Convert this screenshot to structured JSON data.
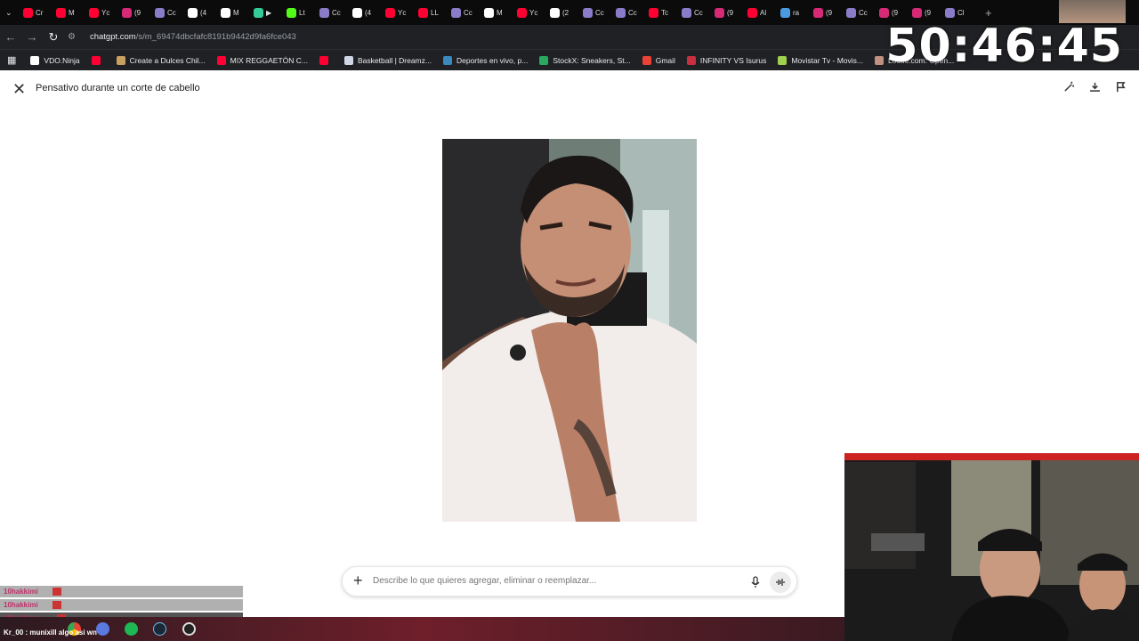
{
  "browser": {
    "tabs": [
      {
        "label": "Cr",
        "icon": "youtube-icon",
        "color": "#ff0033"
      },
      {
        "label": "M",
        "icon": "youtube-icon",
        "color": "#ff0033"
      },
      {
        "label": "Yc",
        "icon": "youtube-icon",
        "color": "#ff0033"
      },
      {
        "label": "(9",
        "icon": "instagram-icon",
        "color": "#d62976"
      },
      {
        "label": "Cc",
        "icon": "feather-icon",
        "color": "#8a7cc8"
      },
      {
        "label": "(4",
        "icon": "tiktok-icon",
        "color": "#ffffff"
      },
      {
        "label": "M",
        "icon": "tiktok-icon",
        "color": "#ffffff"
      },
      {
        "label": "▶",
        "icon": "loading-icon",
        "color": "#3c9"
      },
      {
        "label": "Lt",
        "icon": "kick-icon",
        "color": "#53fc18"
      },
      {
        "label": "Cc",
        "icon": "feather-icon",
        "color": "#8a7cc8"
      },
      {
        "label": "(4",
        "icon": "tiktok-icon",
        "color": "#ffffff"
      },
      {
        "label": "Yc",
        "icon": "youtube-icon",
        "color": "#ff0033"
      },
      {
        "label": "LL",
        "icon": "youtube-icon",
        "color": "#ff0033"
      },
      {
        "label": "Cc",
        "icon": "feather-icon",
        "color": "#8a7cc8"
      },
      {
        "label": "M",
        "icon": "tiktok-icon",
        "color": "#ffffff"
      },
      {
        "label": "Yc",
        "icon": "youtube-icon",
        "color": "#ff0033"
      },
      {
        "label": "(2",
        "icon": "x-icon",
        "color": "#ffffff"
      },
      {
        "label": "Cc",
        "icon": "feather-icon",
        "color": "#8a7cc8"
      },
      {
        "label": "Cc",
        "icon": "feather-icon",
        "color": "#8a7cc8"
      },
      {
        "label": "Tc",
        "icon": "youtube-icon",
        "color": "#ff0033"
      },
      {
        "label": "Cc",
        "icon": "feather-icon",
        "color": "#8a7cc8"
      },
      {
        "label": "(9",
        "icon": "instagram-icon",
        "color": "#d62976"
      },
      {
        "label": "Al",
        "icon": "youtube-icon",
        "color": "#ff0033"
      },
      {
        "label": "ra",
        "icon": "app-icon",
        "color": "#4a9ae0"
      },
      {
        "label": "(9",
        "icon": "instagram-icon",
        "color": "#d62976"
      },
      {
        "label": "Cc",
        "icon": "feather-icon",
        "color": "#8a7cc8"
      },
      {
        "label": "(9",
        "icon": "instagram-icon",
        "color": "#d62976"
      },
      {
        "label": "(9",
        "icon": "instagram-icon",
        "color": "#d62976"
      },
      {
        "label": "Cl",
        "icon": "feather-icon",
        "color": "#8a7cc8"
      }
    ],
    "url_host": "chatgpt.com",
    "url_path": "/s/m_69474dbcfafc8191b9442d9fa6fce043",
    "bookmarks": [
      {
        "label": "VDO.Ninja",
        "color": "#ffffff"
      },
      {
        "label": "",
        "color": "#ff0033"
      },
      {
        "label": "Create a Dulces Chil...",
        "color": "#c8a060"
      },
      {
        "label": "MIX REGGAETÓN C...",
        "color": "#ff0033"
      },
      {
        "label": "",
        "color": "#ff0033"
      },
      {
        "label": "Basketball | Dreamz...",
        "color": "#d0d8e8"
      },
      {
        "label": "Deportes en vivo, p...",
        "color": "#3a8ac0"
      },
      {
        "label": "StockX: Sneakers, St...",
        "color": "#2aa860"
      },
      {
        "label": "Gmail",
        "color": "#ea4335"
      },
      {
        "label": "INFINITY VS Isurus",
        "color": "#c83040"
      },
      {
        "label": "Movistar Tv - Movis...",
        "color": "#a0d050"
      },
      {
        "label": "Lootie.com: Open...",
        "color": "#c09080"
      }
    ]
  },
  "overlay": {
    "timer": "50:46:45"
  },
  "page": {
    "title": "Pensativo durante un corte de cabello",
    "composer_placeholder": "Describe lo que quieres agregar, eliminar o reemplazar..."
  },
  "stream_chat": {
    "rows": [
      "10hakkimi",
      "10hakkimi",
      "10hakkimi :"
    ],
    "last_line": "Kr_00 : munixill algo asi wn"
  }
}
